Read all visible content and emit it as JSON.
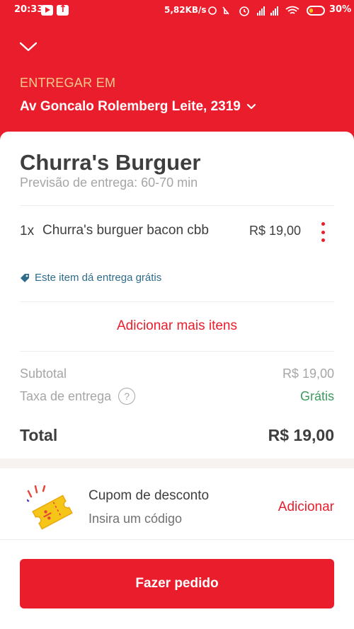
{
  "status_bar": {
    "time": "20:33",
    "network_speed": "5,82KB/s",
    "battery_percent": "30%",
    "battery_level": 0.3
  },
  "header": {
    "deliver_label": "ENTREGAR EM",
    "address": "Av Goncalo Rolemberg Leite, 2319"
  },
  "store": {
    "name": "Churra's Burguer",
    "delivery_estimate": "Previsão de entrega: 60-70 min"
  },
  "items": [
    {
      "qty": "1x",
      "name": "Churra's burguer bacon cbb",
      "price": "R$ 19,00",
      "note": "Este item dá entrega grátis"
    }
  ],
  "add_more_label": "Adicionar mais itens",
  "summary": {
    "subtotal_label": "Subtotal",
    "subtotal_value": "R$ 19,00",
    "delivery_fee_label": "Taxa de entrega",
    "delivery_fee_value": "Grátis",
    "total_label": "Total",
    "total_value": "R$ 19,00"
  },
  "coupon": {
    "title": "Cupom de desconto",
    "subtitle": "Insira um código",
    "action": "Adicionar"
  },
  "order_button": "Fazer pedido",
  "colors": {
    "brand_red": "#ea1d2c",
    "label_gold": "#f7c98b",
    "free_green": "#3c9a5f",
    "note_blue": "#2f6b8a"
  }
}
